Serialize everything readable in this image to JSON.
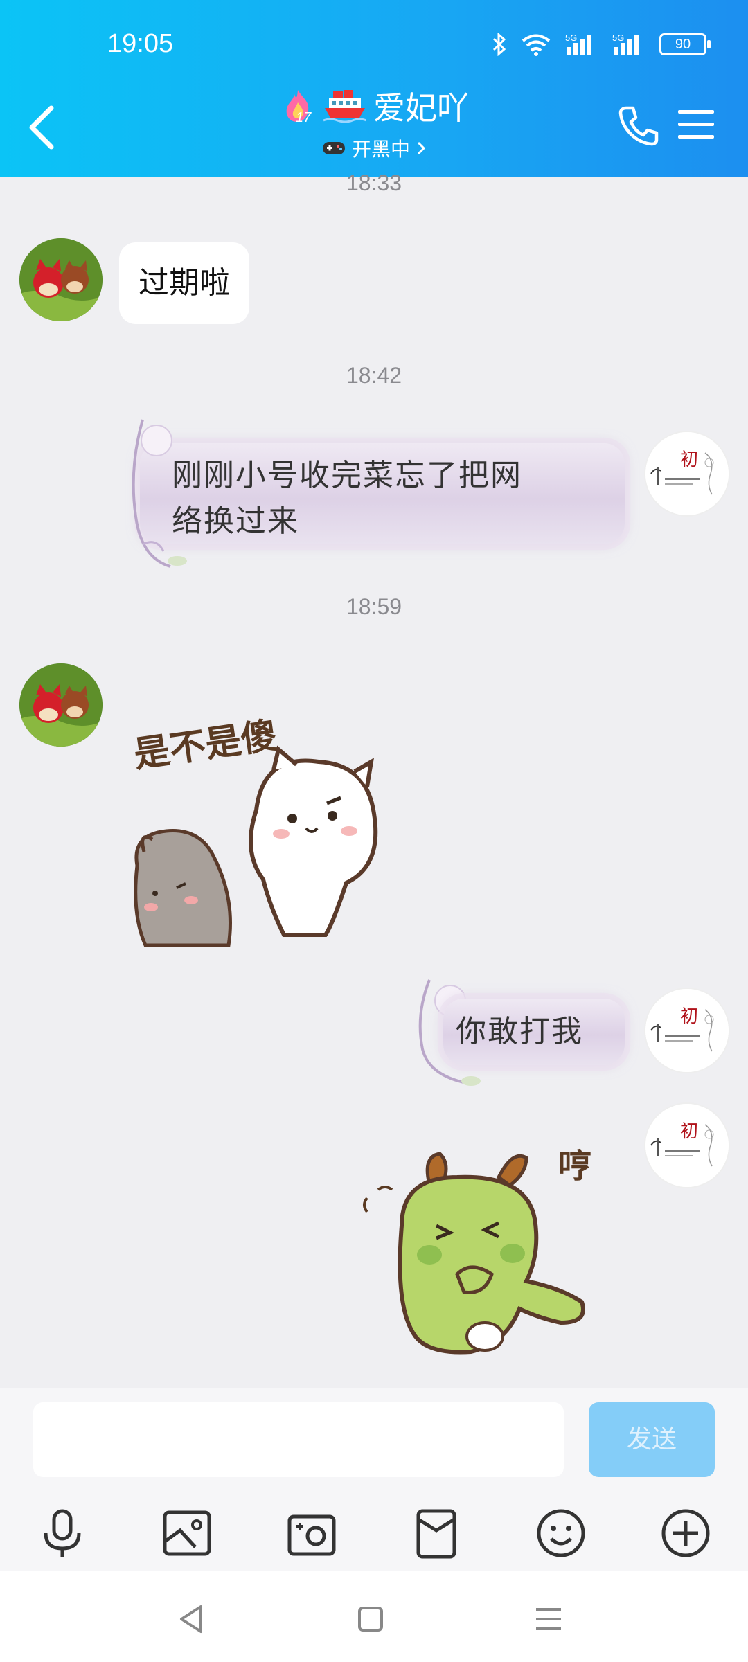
{
  "status_bar": {
    "time": "19:05",
    "battery": "90"
  },
  "header": {
    "contact_name": "爱妃吖",
    "badge_level": "17",
    "subtitle": "开黑中"
  },
  "messages": [
    {
      "type": "time",
      "text": "18:33"
    },
    {
      "type": "text",
      "side": "left",
      "text": "过期啦"
    },
    {
      "type": "time",
      "text": "18:42"
    },
    {
      "type": "text",
      "side": "right",
      "lines": [
        "刚刚小号收完菜忘了把网",
        "络换过来"
      ]
    },
    {
      "type": "time",
      "text": "18:59"
    },
    {
      "type": "sticker",
      "side": "left",
      "caption": "是不是傻"
    },
    {
      "type": "text",
      "side": "right",
      "text": "你敢打我"
    },
    {
      "type": "sticker",
      "side": "right",
      "caption": "哼"
    }
  ],
  "input": {
    "send_label": "发送"
  },
  "colors": {
    "header": "#18a6f3",
    "send_button": "#84cdf8",
    "bubble_purple": "#ddd1e6"
  }
}
